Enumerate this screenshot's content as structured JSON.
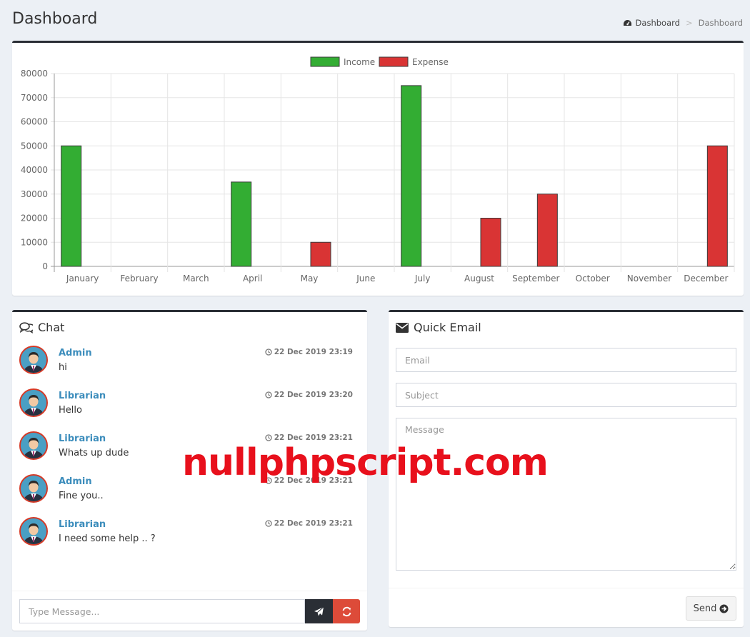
{
  "header": {
    "title": "Dashboard"
  },
  "breadcrumb": {
    "home": "Dashboard",
    "separator": ">",
    "current": "Dashboard"
  },
  "chart_data": {
    "type": "bar",
    "categories": [
      "January",
      "February",
      "March",
      "April",
      "May",
      "June",
      "July",
      "August",
      "September",
      "October",
      "November",
      "December"
    ],
    "series": [
      {
        "name": "Income",
        "color": "#33ad33",
        "values": [
          50000,
          0,
          0,
          35000,
          0,
          0,
          75000,
          0,
          0,
          0,
          0,
          0
        ]
      },
      {
        "name": "Expense",
        "color": "#d93434",
        "values": [
          0,
          0,
          0,
          0,
          10000,
          0,
          0,
          20000,
          30000,
          0,
          0,
          50000
        ]
      }
    ],
    "yticks": [
      "0",
      "10000",
      "20000",
      "30000",
      "40000",
      "50000",
      "60000",
      "70000",
      "80000"
    ],
    "ylim": [
      0,
      80000
    ],
    "grid": true,
    "legend": "top-center"
  },
  "chat": {
    "title": "Chat",
    "messages": [
      {
        "name": "Admin",
        "text": "hi",
        "time": "22 Dec 2019 23:19"
      },
      {
        "name": "Librarian",
        "text": "Hello",
        "time": "22 Dec 2019 23:20"
      },
      {
        "name": "Librarian",
        "text": "Whats up dude",
        "time": "22 Dec 2019 23:21"
      },
      {
        "name": "Admin",
        "text": "Fine you..",
        "time": "22 Dec 2019 23:21"
      },
      {
        "name": "Librarian",
        "text": "I need some help .. ?",
        "time": "22 Dec 2019 23:21"
      }
    ],
    "input_placeholder": "Type Message..."
  },
  "email": {
    "title": "Quick Email",
    "email_placeholder": "Email",
    "subject_placeholder": "Subject",
    "message_placeholder": "Message",
    "send_label": "Send"
  },
  "watermark": "nullphpscript.com"
}
